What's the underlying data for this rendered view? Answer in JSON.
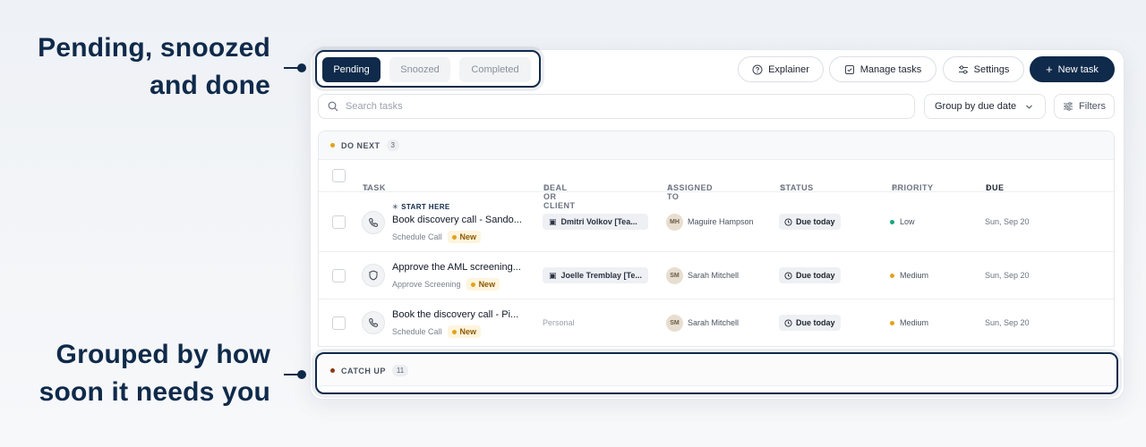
{
  "callouts": {
    "top": "Pending, snoozed and done",
    "bottom": "Grouped by how soon it needs you"
  },
  "tabs": [
    {
      "label": "Pending",
      "active": true
    },
    {
      "label": "Snoozed",
      "active": false
    },
    {
      "label": "Completed",
      "active": false
    }
  ],
  "toolbar": {
    "explainer": "Explainer",
    "manage_tasks": "Manage tasks",
    "settings": "Settings",
    "new_task": "New task"
  },
  "search": {
    "placeholder": "Search tasks",
    "value": ""
  },
  "group_select": {
    "value": "Group by due date"
  },
  "filters": {
    "label": "Filters"
  },
  "columns": {
    "task": "TASK",
    "deal": "DEAL OR CLIENT",
    "assigned": "ASSIGNED TO",
    "status": "STATUS",
    "priority": "PRIORITY",
    "due": "DUE"
  },
  "groups": [
    {
      "label": "DO NEXT",
      "count": "3",
      "color": "#e2a21b"
    },
    {
      "label": "CATCH UP",
      "count": "11",
      "color": "#8a3b12"
    }
  ],
  "start_here": "START HERE",
  "badge_new": "New",
  "rows": [
    {
      "icon": "phone-icon",
      "title": "Book discovery call - Sando...",
      "subtitle": "Schedule Call",
      "deal": "Dmitri Volkov [Tea...",
      "initials": "MH",
      "assignee": "Maguire Hampson",
      "status": "Due today",
      "priority": "Low",
      "priority_color": "#1aa67a",
      "due": "Sun, Sep 20"
    },
    {
      "icon": "shield-icon",
      "title": "Approve the AML screening...",
      "subtitle": "Approve Screening",
      "deal": "Joelle Tremblay [Te...",
      "initials": "SM",
      "assignee": "Sarah Mitchell",
      "status": "Due today",
      "priority": "Medium",
      "priority_color": "#e2a21b",
      "due": "Sun, Sep 20"
    },
    {
      "icon": "phone-icon",
      "title": "Book the discovery call - Pi...",
      "subtitle": "Schedule Call",
      "deal": "Personal",
      "initials": "SM",
      "assignee": "Sarah Mitchell",
      "status": "Due today",
      "priority": "Medium",
      "priority_color": "#e2a21b",
      "due": "Sun, Sep 20"
    }
  ]
}
